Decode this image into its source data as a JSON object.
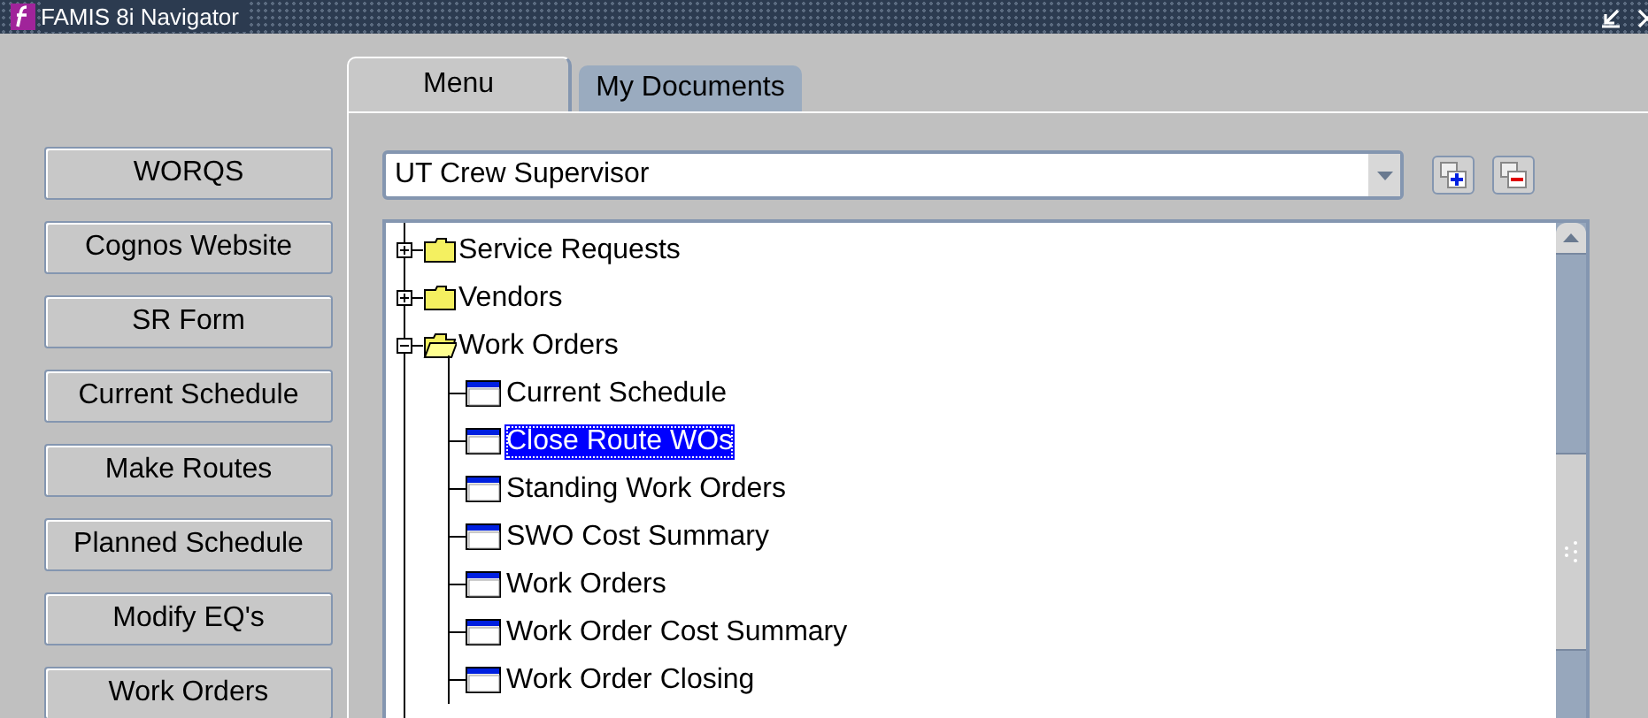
{
  "window": {
    "title": "FAMIS 8i Navigator"
  },
  "shortcuts": [
    {
      "label": "WORQS"
    },
    {
      "label": "Cognos Website"
    },
    {
      "label": "SR Form"
    },
    {
      "label": "Current Schedule"
    },
    {
      "label": "Make Routes"
    },
    {
      "label": "Planned Schedule"
    },
    {
      "label": "Modify EQ's"
    },
    {
      "label": "Work Orders"
    }
  ],
  "tabs": [
    {
      "label": "Menu",
      "selected": true
    },
    {
      "label": "My Documents",
      "selected": false
    }
  ],
  "responsibility": {
    "value": "UT Crew Supervisor"
  },
  "tree": [
    {
      "label": "Service Requests",
      "kind": "folder",
      "expanded": false,
      "selected": false
    },
    {
      "label": "Vendors",
      "kind": "folder",
      "expanded": false,
      "selected": false
    },
    {
      "label": "Work Orders",
      "kind": "folder",
      "expanded": true,
      "selected": false,
      "children": [
        {
          "label": "Current Schedule",
          "kind": "form",
          "selected": false
        },
        {
          "label": "Close Route WOs",
          "kind": "form",
          "selected": true
        },
        {
          "label": "Standing Work Orders",
          "kind": "form",
          "selected": false
        },
        {
          "label": "SWO Cost Summary",
          "kind": "form",
          "selected": false
        },
        {
          "label": "Work Orders",
          "kind": "form",
          "selected": false
        },
        {
          "label": "Work Order Cost Summary",
          "kind": "form",
          "selected": false
        },
        {
          "label": "Work Order Closing",
          "kind": "form",
          "selected": false
        }
      ]
    }
  ]
}
